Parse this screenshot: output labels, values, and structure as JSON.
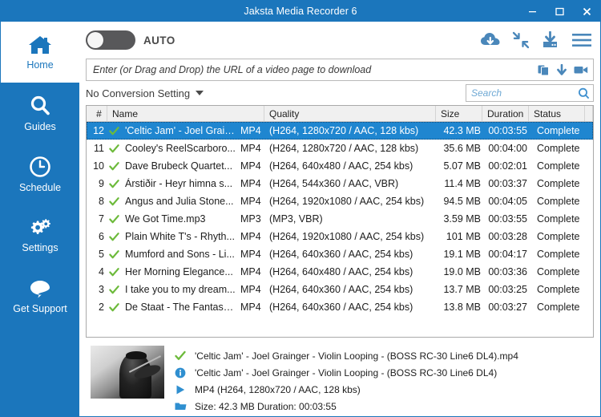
{
  "window": {
    "title": "Jaksta Media Recorder 6",
    "accent": "#1b76bc",
    "icon_blue": "#4a87ba",
    "selection_blue": "#1f86d0",
    "check_green": "#6cba3a",
    "minimize_label": "–",
    "maximize_label": "☐",
    "close_label": "✕"
  },
  "sidebar": {
    "items": [
      {
        "label": "Home",
        "icon": "home-icon",
        "active": true
      },
      {
        "label": "Guides",
        "icon": "search-icon",
        "active": false
      },
      {
        "label": "Schedule",
        "icon": "clock-icon",
        "active": false
      },
      {
        "label": "Settings",
        "icon": "gears-icon",
        "active": false
      },
      {
        "label": "Get Support",
        "icon": "chat-bubble-icon",
        "active": false
      }
    ]
  },
  "toolbar": {
    "auto_label": "AUTO",
    "toggle_state": "off",
    "icons": [
      {
        "name": "cloud-download-icon"
      },
      {
        "name": "collapse-arrows-icon"
      },
      {
        "name": "download-to-tray-icon"
      },
      {
        "name": "hamburger-menu-icon"
      }
    ]
  },
  "urlbar": {
    "value": "",
    "placeholder": "Enter (or Drag and Drop) the URL of a video page to download",
    "icons": [
      {
        "name": "paste-icon"
      },
      {
        "name": "download-arrow-icon"
      },
      {
        "name": "video-camera-icon"
      }
    ]
  },
  "conversion": {
    "label": "No Conversion Setting"
  },
  "search": {
    "value": "",
    "placeholder": "Search"
  },
  "table": {
    "columns": [
      "#",
      "Name",
      "Quality",
      "Size",
      "Duration",
      "Status"
    ],
    "rows": [
      {
        "num": "12",
        "name": "'Celtic Jam'  - Joel Grain...",
        "format": "MP4",
        "quality": "(H264, 1280x720 / AAC, 128 kbs)",
        "size": "42.3 MB",
        "duration": "00:03:55",
        "status": "Complete",
        "selected": true
      },
      {
        "num": "11",
        "name": "Cooley's  ReelScarboro...",
        "format": "MP4",
        "quality": "(H264, 1280x720 / AAC, 128 kbs)",
        "size": "35.6 MB",
        "duration": "00:04:00",
        "status": "Complete",
        "selected": false
      },
      {
        "num": "10",
        "name": "Dave  Brubeck  Quartet...",
        "format": "MP4",
        "quality": "(H264, 640x480 / AAC, 254 kbs)",
        "size": "5.07 MB",
        "duration": "00:02:01",
        "status": "Complete",
        "selected": false
      },
      {
        "num": "9",
        "name": "Árstiðir - Heyr himna s...",
        "format": "MP4",
        "quality": "(H264, 544x360 / AAC, VBR)",
        "size": "11.4 MB",
        "duration": "00:03:37",
        "status": "Complete",
        "selected": false
      },
      {
        "num": "8",
        "name": "Angus and Julia Stone...",
        "format": "MP4",
        "quality": "(H264, 1920x1080 / AAC, 254 kbs)",
        "size": "94.5 MB",
        "duration": "00:04:05",
        "status": "Complete",
        "selected": false
      },
      {
        "num": "7",
        "name": "We Got Time.mp3",
        "format": "MP3",
        "quality": "(MP3, VBR)",
        "size": "3.59 MB",
        "duration": "00:03:55",
        "status": "Complete",
        "selected": false
      },
      {
        "num": "6",
        "name": "Plain White T's  - Rhyth...",
        "format": "MP4",
        "quality": "(H264, 1920x1080 / AAC, 254 kbs)",
        "size": "101 MB",
        "duration": "00:03:28",
        "status": "Complete",
        "selected": false
      },
      {
        "num": "5",
        "name": "Mumford and Sons - Li...",
        "format": "MP4",
        "quality": "(H264, 640x360 / AAC, 254 kbs)",
        "size": "19.1 MB",
        "duration": "00:04:17",
        "status": "Complete",
        "selected": false
      },
      {
        "num": "4",
        "name": "Her  Morning  Elegance...",
        "format": "MP4",
        "quality": "(H264, 640x480 / AAC, 254 kbs)",
        "size": "19.0 MB",
        "duration": "00:03:36",
        "status": "Complete",
        "selected": false
      },
      {
        "num": "3",
        "name": "I take you to my dream...",
        "format": "MP4",
        "quality": "(H264, 640x360 / AAC, 254 kbs)",
        "size": "13.7 MB",
        "duration": "00:03:25",
        "status": "Complete",
        "selected": false
      },
      {
        "num": "2",
        "name": "De  Staat  -  The Fantasti...",
        "format": "MP4",
        "quality": "(H264, 640x360 / AAC, 254 kbs)",
        "size": "13.8 MB",
        "duration": "00:03:27",
        "status": "Complete",
        "selected": false
      }
    ]
  },
  "detail": {
    "thumbnail_alt": "violin-player-photo",
    "lines": [
      {
        "icon": "green-check-icon",
        "text": "'Celtic Jam'  - Joel Grainger - Violin Looping - (BOSS RC-30  Line6 DL4).mp4"
      },
      {
        "icon": "info-icon",
        "text": "'Celtic Jam'  - Joel Grainger -  Violin Looping - (BOSS RC-30   Line6 DL4)"
      },
      {
        "icon": "play-icon",
        "text": "MP4  (H264, 1280x720 / AAC, 128 kbs)"
      },
      {
        "icon": "folder-icon",
        "text": "Size:  42.3 MB     Duration: 00:03:55"
      }
    ]
  }
}
